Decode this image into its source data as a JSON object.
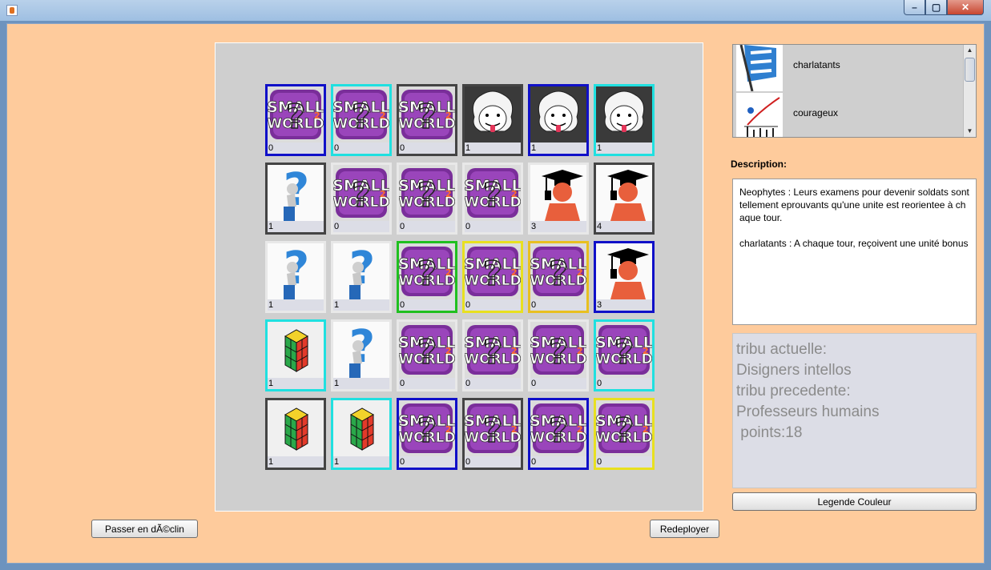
{
  "window": {
    "min_label": "–",
    "max_label": "▢",
    "close_label": "✕"
  },
  "sidebar": {
    "tribes": [
      {
        "label": "charlatants",
        "icon": "flag-icon"
      },
      {
        "label": "courageux",
        "icon": "chart-icon"
      }
    ],
    "description_label": "Description:",
    "description": [
      "Neophytes : Leurs examens pour devenir soldats sont tellement eprouvants qu'une unite est reorientee à chaque tour.",
      "charlatants :  A  chaque tour, reçoivent une unité bonus"
    ],
    "status": {
      "l1": "tribu actuelle:",
      "l2": "Disigners intellos",
      "l3": "",
      "l4": "tribu precedente:",
      "l5": "Professeurs humains",
      "l6": " points:18"
    },
    "legend_button": "Legende Couleur"
  },
  "buttons": {
    "decline": "Passer en dÃ©clin",
    "redeploy": "Redeployer"
  },
  "colors": {
    "background": "#fecb9c",
    "board": "#cfcfcf"
  },
  "board": {
    "rows": [
      [
        {
          "type": "smallworld",
          "count": "0",
          "border": "#1010c8"
        },
        {
          "type": "smallworld",
          "count": "0",
          "border": "#20e0e0"
        },
        {
          "type": "smallworld",
          "count": "0",
          "border": "#444444"
        },
        {
          "type": "einstein",
          "count": "1",
          "border": "#444444"
        },
        {
          "type": "einstein",
          "count": "1",
          "border": "#1010c8"
        },
        {
          "type": "einstein",
          "count": "1",
          "border": "#20e0e0"
        }
      ],
      [
        {
          "type": "question",
          "count": "1",
          "border": "#444444"
        },
        {
          "type": "smallworld",
          "count": "0",
          "border": "#e8e8e8"
        },
        {
          "type": "smallworld",
          "count": "0",
          "border": "#e8e8e8"
        },
        {
          "type": "smallworld",
          "count": "0",
          "border": "#e8e8e8"
        },
        {
          "type": "graduate",
          "count": "3",
          "border": "#e8e8e8"
        },
        {
          "type": "graduate",
          "count": "4",
          "border": "#444444"
        }
      ],
      [
        {
          "type": "question",
          "count": "1",
          "border": "#e8e8e8"
        },
        {
          "type": "question",
          "count": "1",
          "border": "#e8e8e8"
        },
        {
          "type": "smallworld",
          "count": "0",
          "border": "#20c020"
        },
        {
          "type": "smallworld",
          "count": "0",
          "border": "#e8e020"
        },
        {
          "type": "smallworld",
          "count": "0",
          "border": "#e8c020"
        },
        {
          "type": "graduate",
          "count": "3",
          "border": "#1010c8"
        }
      ],
      [
        {
          "type": "rubik",
          "count": "1",
          "border": "#20e0e0"
        },
        {
          "type": "question",
          "count": "1",
          "border": "#e8e8e8"
        },
        {
          "type": "smallworld",
          "count": "0",
          "border": "#e8e8e8"
        },
        {
          "type": "smallworld",
          "count": "0",
          "border": "#e8e8e8"
        },
        {
          "type": "smallworld",
          "count": "0",
          "border": "#e8e8e8"
        },
        {
          "type": "smallworld",
          "count": "0",
          "border": "#20e0e0"
        }
      ],
      [
        {
          "type": "rubik",
          "count": "1",
          "border": "#444444"
        },
        {
          "type": "rubik",
          "count": "1",
          "border": "#20e0e0"
        },
        {
          "type": "smallworld",
          "count": "0",
          "border": "#1010c8"
        },
        {
          "type": "smallworld",
          "count": "0",
          "border": "#444444"
        },
        {
          "type": "smallworld",
          "count": "0",
          "border": "#1010c8"
        },
        {
          "type": "smallworld",
          "count": "0",
          "border": "#e8e020"
        }
      ]
    ]
  }
}
